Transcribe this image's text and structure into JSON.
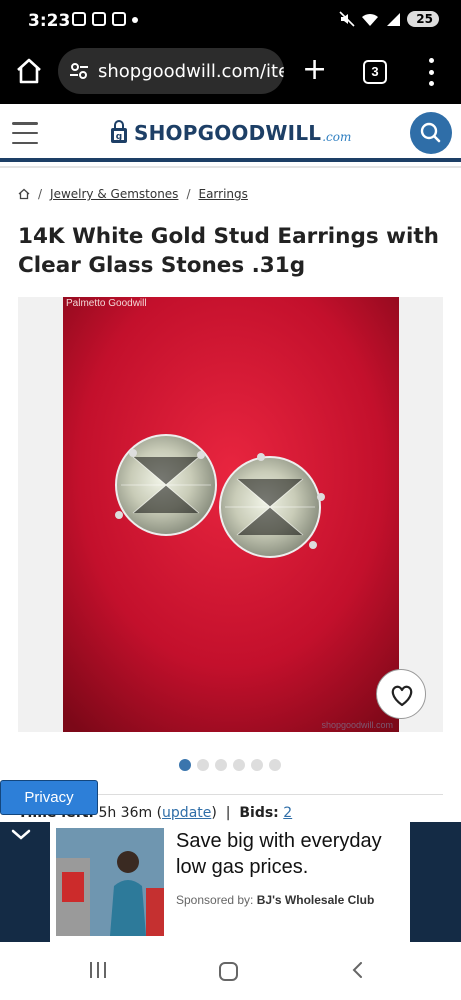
{
  "status_bar": {
    "time": "3:23",
    "battery": "25"
  },
  "browser": {
    "url": "shopgoodwill.com/ite",
    "tab_count": "3"
  },
  "site": {
    "logo_text": "SHOPGOODWILL",
    "logo_suffix": ".com"
  },
  "breadcrumb": {
    "items": [
      "Jewelry & Gemstones",
      "Earrings"
    ]
  },
  "listing": {
    "title": "14K White Gold Stud Earrings with Clear Glass Stones .31g",
    "photo_label": "Palmetto Goodwill",
    "image_count": 6,
    "active_image": 1,
    "time_left_label": "Time left:",
    "time_left_value": "5h 36m",
    "update_link": "update",
    "bids_label": "Bids:",
    "bids_value": "2"
  },
  "privacy": {
    "label": "Privacy"
  },
  "ad": {
    "headline": "Save big with everyday low gas prices.",
    "sponsored_label": "Sponsored by:",
    "sponsor": "BJ's Wholesale Club"
  },
  "colors": {
    "brand_navy": "#1d3f66",
    "brand_blue": "#2f6ea8",
    "privacy_blue": "#2d7fd8",
    "photo_red": "#c3102c"
  }
}
